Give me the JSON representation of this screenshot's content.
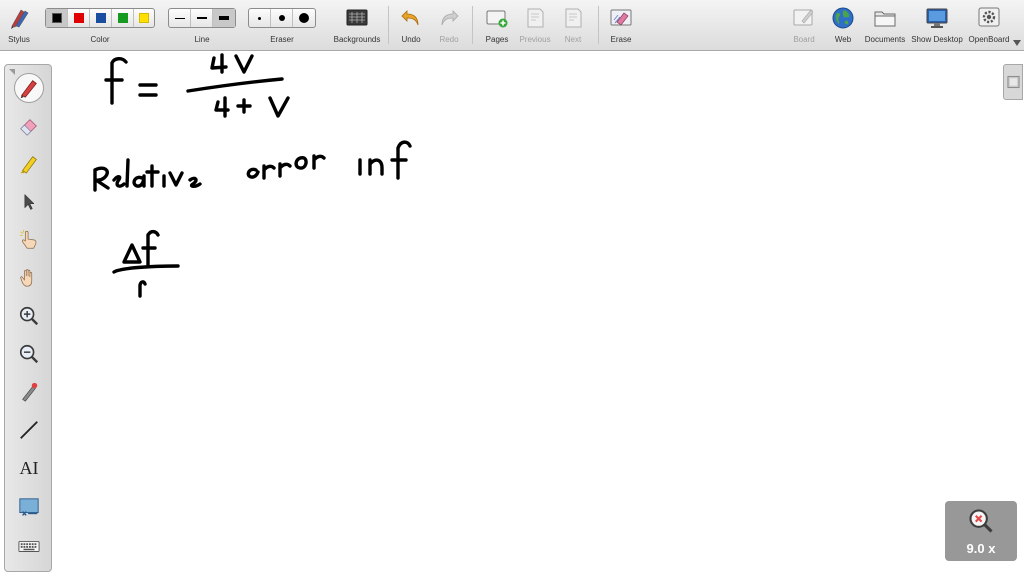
{
  "toolbar": {
    "stylus_label": "Stylus",
    "color_label": "Color",
    "line_label": "Line",
    "eraser_label": "Eraser",
    "backgrounds_label": "Backgrounds",
    "undo_label": "Undo",
    "redo_label": "Redo",
    "pages_label": "Pages",
    "previous_label": "Previous",
    "next_label": "Next",
    "erase_label": "Erase",
    "board_label": "Board",
    "web_label": "Web",
    "documents_label": "Documents",
    "show_desktop_label": "Show Desktop",
    "openboard_label": "OpenBoard",
    "colors": [
      "#000000",
      "#e00000",
      "#1a4fa0",
      "#169a1f",
      "#ffe000"
    ],
    "selected_color": "#000000"
  },
  "palette": {
    "tools": [
      "pen-icon",
      "eraser-icon",
      "highlighter-icon",
      "pointer-icon",
      "hand-pointer-icon",
      "hand-icon",
      "zoom-in-icon",
      "zoom-out-icon",
      "laser-icon",
      "line-icon",
      "text-icon",
      "capture-icon",
      "keyboard-icon"
    ],
    "text_tool_glyph": "AI"
  },
  "zoom": {
    "value": "9.0 x"
  }
}
